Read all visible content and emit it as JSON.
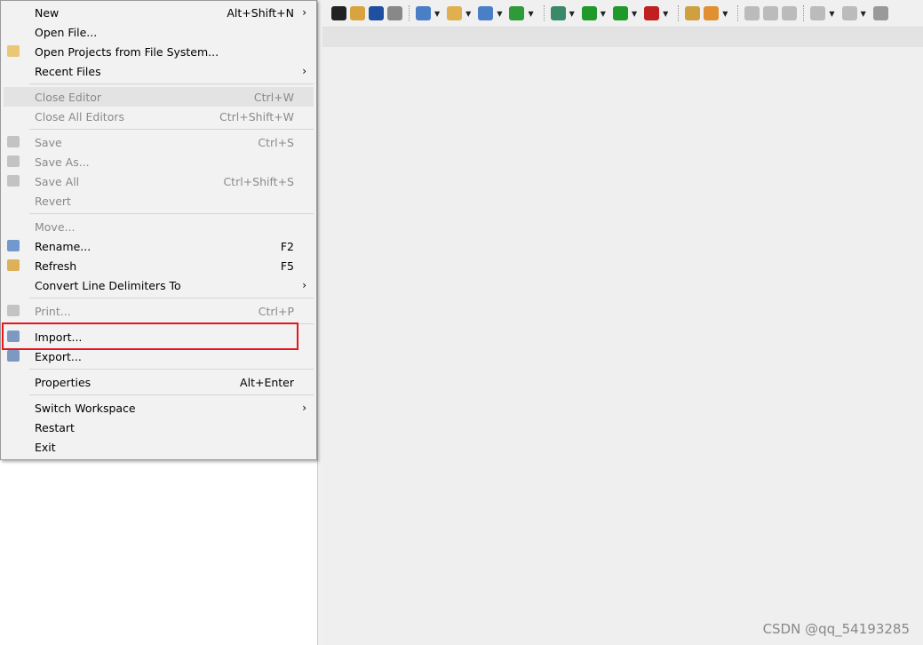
{
  "menu": {
    "items": [
      {
        "label": "New",
        "shortcut": "Alt+Shift+N",
        "submenu": true
      },
      {
        "label": "Open File..."
      },
      {
        "label": "Open Projects from File System...",
        "icon": "folder-icon"
      },
      {
        "label": "Recent Files",
        "submenu": true
      },
      {
        "sep": true
      },
      {
        "label": "Close Editor",
        "shortcut": "Ctrl+W",
        "disabled": true,
        "highlighted": true
      },
      {
        "label": "Close All Editors",
        "shortcut": "Ctrl+Shift+W",
        "disabled": true
      },
      {
        "sep": true
      },
      {
        "label": "Save",
        "shortcut": "Ctrl+S",
        "disabled": true,
        "icon": "save-icon"
      },
      {
        "label": "Save As...",
        "disabled": true,
        "icon": "save-as-icon"
      },
      {
        "label": "Save All",
        "shortcut": "Ctrl+Shift+S",
        "disabled": true,
        "icon": "save-all-icon"
      },
      {
        "label": "Revert",
        "disabled": true
      },
      {
        "sep": true
      },
      {
        "label": "Move...",
        "disabled": true
      },
      {
        "label": "Rename...",
        "shortcut": "F2",
        "icon": "rename-icon"
      },
      {
        "label": "Refresh",
        "shortcut": "F5",
        "icon": "refresh-icon"
      },
      {
        "label": "Convert Line Delimiters To",
        "submenu": true
      },
      {
        "sep": true
      },
      {
        "label": "Print...",
        "shortcut": "Ctrl+P",
        "disabled": true,
        "icon": "print-icon"
      },
      {
        "sep": true
      },
      {
        "label": "Import...",
        "icon": "import-icon"
      },
      {
        "label": "Export...",
        "icon": "export-icon"
      },
      {
        "sep": true
      },
      {
        "label": "Properties",
        "shortcut": "Alt+Enter"
      },
      {
        "sep": true
      },
      {
        "label": "Switch Workspace",
        "submenu": true
      },
      {
        "label": "Restart"
      },
      {
        "label": "Exit"
      }
    ]
  },
  "toolbar": {
    "icons": [
      {
        "name": "build-icon",
        "color": "#222"
      },
      {
        "name": "task-icon",
        "color": "#d9a440"
      },
      {
        "name": "search-icon",
        "color": "#1f4fa0"
      },
      {
        "name": "web-icon",
        "color": "#888"
      },
      {
        "sep": true
      },
      {
        "name": "new-package-icon",
        "color": "#4a7fc8",
        "dd": true
      },
      {
        "name": "new-folder-icon",
        "color": "#e0b050",
        "dd": true
      },
      {
        "name": "new-class-icon",
        "color": "#4a7fc8",
        "dd": true
      },
      {
        "name": "new-interface-icon",
        "color": "#2e9a3a",
        "dd": true
      },
      {
        "sep": true
      },
      {
        "name": "debug-icon",
        "color": "#3a8a6a",
        "dd": true
      },
      {
        "name": "run-icon",
        "color": "#1f9a2a",
        "dd": true
      },
      {
        "name": "coverage-icon",
        "color": "#1f9a2a",
        "dd": true
      },
      {
        "name": "external-tools-icon",
        "color": "#c02020",
        "dd": true
      },
      {
        "sep": true
      },
      {
        "name": "open-type-icon",
        "color": "#d0a040"
      },
      {
        "name": "marker-icon",
        "color": "#e09030",
        "dd": true
      },
      {
        "sep": true
      },
      {
        "name": "toggle-breadcrumb-icon",
        "color": "#bbb"
      },
      {
        "name": "block-selection-icon",
        "color": "#bbb"
      },
      {
        "name": "show-whitespace-icon",
        "color": "#bbb"
      },
      {
        "sep": true
      },
      {
        "name": "next-annotation-icon",
        "color": "#bbb",
        "dd": true
      },
      {
        "name": "previous-annotation-icon",
        "color": "#bbb",
        "dd": true
      },
      {
        "name": "back-icon",
        "color": "#999"
      }
    ]
  },
  "watermark": "CSDN @qq_54193285",
  "highlight_color": "#e8141e"
}
